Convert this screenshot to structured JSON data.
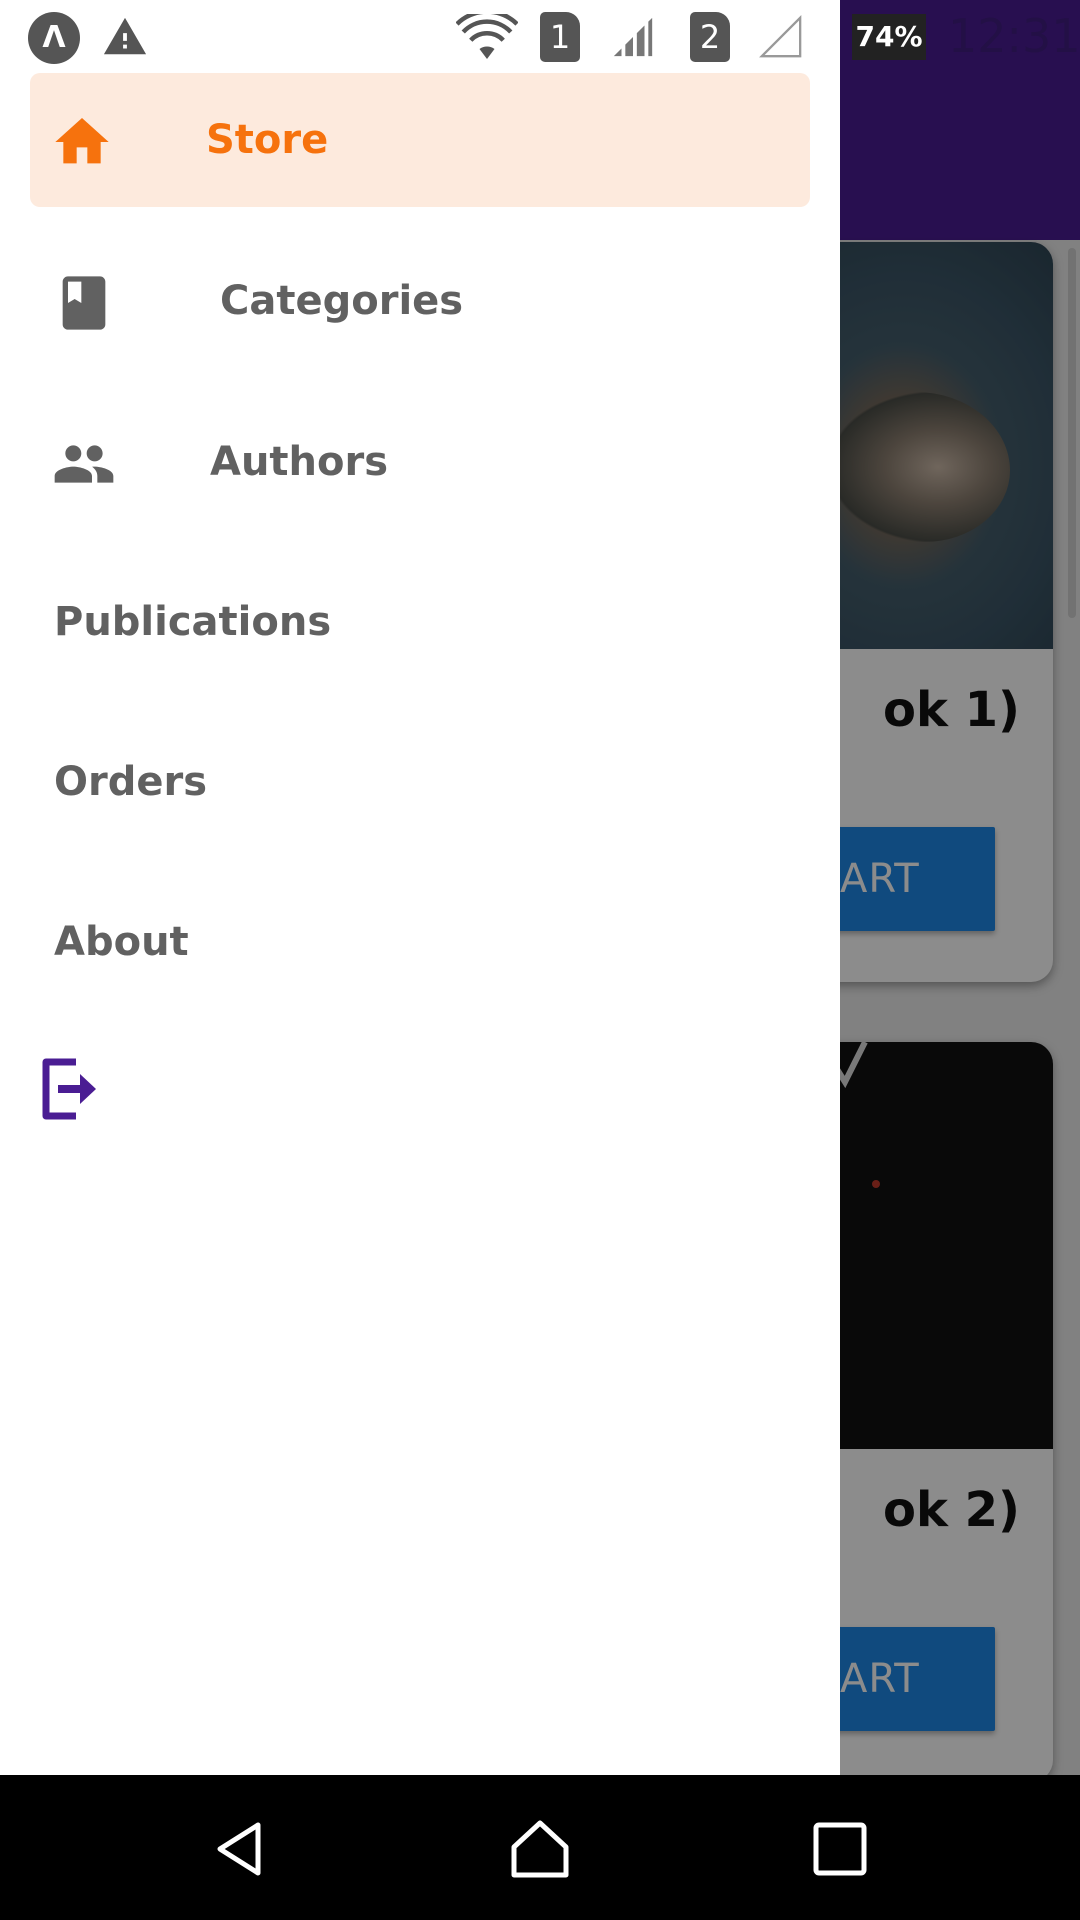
{
  "status_bar": {
    "sim1": "1",
    "sim2": "2",
    "battery": "74%",
    "time": "12:31",
    "icons": [
      "app-logo-icon",
      "warning-icon",
      "wifi-icon",
      "signal-icon",
      "signal-empty-icon"
    ]
  },
  "drawer": {
    "items": [
      {
        "label": "Store",
        "icon": "home-icon",
        "active": true
      },
      {
        "label": "Categories",
        "icon": "book-icon"
      },
      {
        "label": "Authors",
        "icon": "people-icon"
      },
      {
        "label": "Publications"
      },
      {
        "label": "Orders"
      },
      {
        "label": "About"
      }
    ],
    "logout_icon": "logout-icon"
  },
  "background": {
    "cards": [
      {
        "title_fragment": "ok 1)",
        "button_fragment": "ART"
      },
      {
        "title_fragment": "ok 2)",
        "button_fragment": "ART"
      }
    ]
  },
  "colors": {
    "accent": "#f6720d",
    "active_bg": "#fdeadd",
    "appbar": "#4a1d93",
    "logout": "#4a1d93",
    "menu_text": "#616161",
    "cart_button": "#1e88e5"
  },
  "nav_bar": {
    "icons": [
      "back-icon",
      "home-nav-icon",
      "recents-icon"
    ]
  }
}
